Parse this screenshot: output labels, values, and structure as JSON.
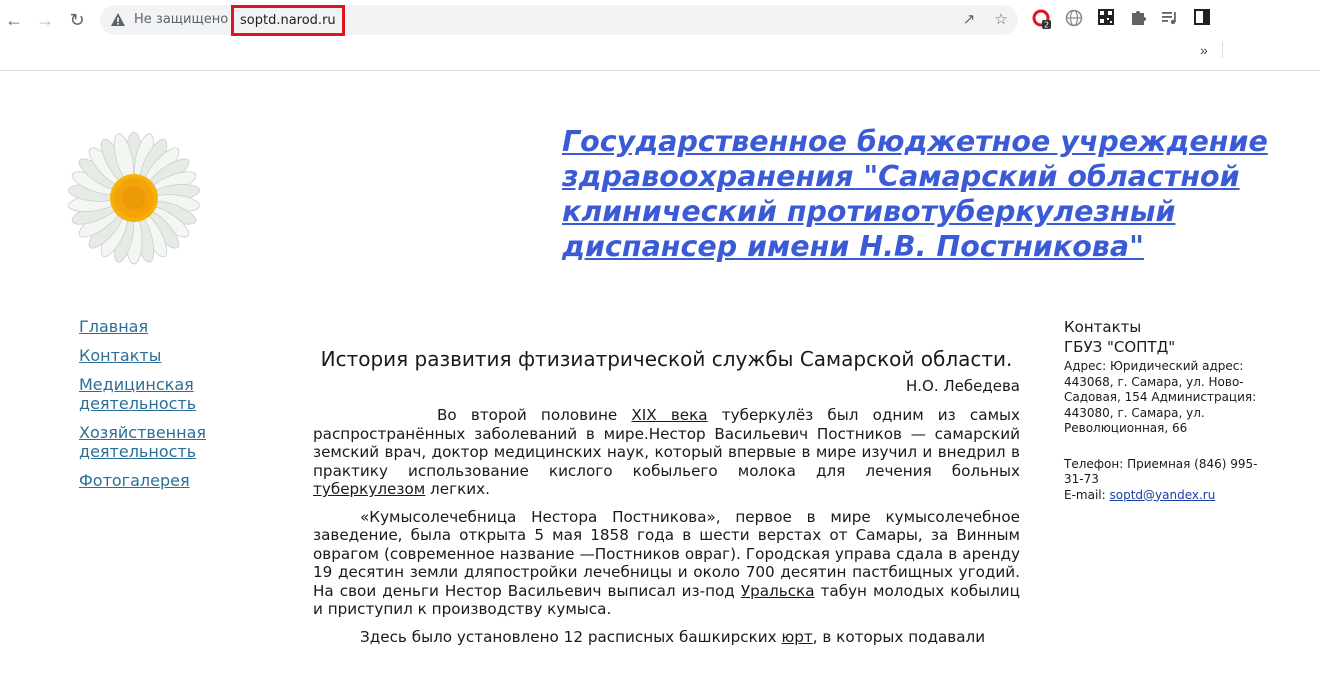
{
  "browser": {
    "security_label": "Не защищено",
    "url": "soptd.narod.ru",
    "overflow_label": "»",
    "extension_badge": "2"
  },
  "site": {
    "title": "Государственное бюджетное учреждение здравоохранения \"Самарский областной клинический противотуберкулезный диспансер имени Н.В. Постникова\""
  },
  "nav": {
    "items": [
      {
        "label": "Главная"
      },
      {
        "label": "Контакты"
      },
      {
        "label": "Медицинская деятельность"
      },
      {
        "label": "Хозяйственная деятельность"
      },
      {
        "label": "Фотогалерея"
      }
    ]
  },
  "article": {
    "title": "История развития фтизиатрической службы Самарской области.",
    "author": "Н.О. Лебедева",
    "p1": {
      "before_link1": "Во второй половине ",
      "link1": "XIX века",
      "mid": " туберкулёз был одним из самых распространённых заболеваний в мире.Нестор Васильевич Постников — самарский земский врач, доктор медицинских наук, который впервые в мире изучил и внедрил в практику использование кислого кобыльего молока для  лечения больных ",
      "link2": "туберкулезом",
      "after": " легких."
    },
    "p2": {
      "text": "«Кумысолечебница Нестора Постникова», первое в мире кумысолечебное заведение, была открыта 5 мая 1858 года в шести верстах от Самары, за Винным оврагом (современное название —Постников овраг). Городская управа сдала в аренду 19 десятин земли дляпостройки лечебницы и около 700 десятин пастбищных угодий. На свои деньги Нестор Васильевич выписал из-под ",
      "link": "Уральска",
      "after": " табун молодых кобылиц и приступил к производству кумыса."
    },
    "p3": {
      "text": "Здесь было установлено 12 расписных башкирских ",
      "link": "юрт",
      "after": ", в которых подавали"
    }
  },
  "contacts": {
    "heading": "Контакты",
    "org": "ГБУЗ \"СОПТД\"",
    "address": "Адрес: Юридический адрес: 443068, г. Самара, ул. Ново-Садовая, 154 Администрация: 443080, г. Самара, ул. Революционная, 66",
    "phone": "Телефон: Приемная (846) 995-31-73",
    "email_label": "E-mail: ",
    "email": "soptd@yandex.ru"
  }
}
